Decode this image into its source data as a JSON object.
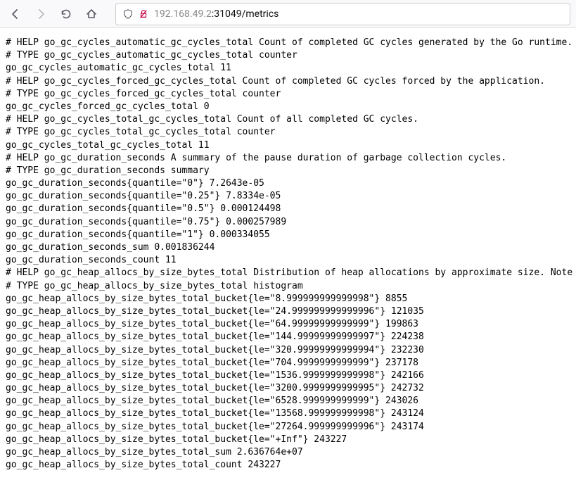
{
  "url": {
    "host": "192.168.49.2",
    "port_path": ":31049/metrics"
  },
  "metrics": [
    "# HELP go_gc_cycles_automatic_gc_cycles_total Count of completed GC cycles generated by the Go runtime.",
    "# TYPE go_gc_cycles_automatic_gc_cycles_total counter",
    "go_gc_cycles_automatic_gc_cycles_total 11",
    "# HELP go_gc_cycles_forced_gc_cycles_total Count of completed GC cycles forced by the application.",
    "# TYPE go_gc_cycles_forced_gc_cycles_total counter",
    "go_gc_cycles_forced_gc_cycles_total 0",
    "# HELP go_gc_cycles_total_gc_cycles_total Count of all completed GC cycles.",
    "# TYPE go_gc_cycles_total_gc_cycles_total counter",
    "go_gc_cycles_total_gc_cycles_total 11",
    "# HELP go_gc_duration_seconds A summary of the pause duration of garbage collection cycles.",
    "# TYPE go_gc_duration_seconds summary",
    "go_gc_duration_seconds{quantile=\"0\"} 7.2643e-05",
    "go_gc_duration_seconds{quantile=\"0.25\"} 7.8334e-05",
    "go_gc_duration_seconds{quantile=\"0.5\"} 0.000124498",
    "go_gc_duration_seconds{quantile=\"0.75\"} 0.000257989",
    "go_gc_duration_seconds{quantile=\"1\"} 0.000334055",
    "go_gc_duration_seconds_sum 0.001836244",
    "go_gc_duration_seconds_count 11",
    "# HELP go_gc_heap_allocs_by_size_bytes_total Distribution of heap allocations by approximate size. Note that thi",
    "# TYPE go_gc_heap_allocs_by_size_bytes_total histogram",
    "go_gc_heap_allocs_by_size_bytes_total_bucket{le=\"8.999999999999998\"} 8855",
    "go_gc_heap_allocs_by_size_bytes_total_bucket{le=\"24.999999999999996\"} 121035",
    "go_gc_heap_allocs_by_size_bytes_total_bucket{le=\"64.99999999999999\"} 199863",
    "go_gc_heap_allocs_by_size_bytes_total_bucket{le=\"144.99999999999997\"} 224238",
    "go_gc_heap_allocs_by_size_bytes_total_bucket{le=\"320.99999999999994\"} 232230",
    "go_gc_heap_allocs_by_size_bytes_total_bucket{le=\"704.9999999999999\"} 237178",
    "go_gc_heap_allocs_by_size_bytes_total_bucket{le=\"1536.9999999999998\"} 242166",
    "go_gc_heap_allocs_by_size_bytes_total_bucket{le=\"3200.9999999999995\"} 242732",
    "go_gc_heap_allocs_by_size_bytes_total_bucket{le=\"6528.999999999999\"} 243026",
    "go_gc_heap_allocs_by_size_bytes_total_bucket{le=\"13568.999999999998\"} 243124",
    "go_gc_heap_allocs_by_size_bytes_total_bucket{le=\"27264.999999999996\"} 243174",
    "go_gc_heap_allocs_by_size_bytes_total_bucket{le=\"+Inf\"} 243227",
    "go_gc_heap_allocs_by_size_bytes_total_sum 2.636764e+07",
    "go_gc_heap_allocs_by_size_bytes_total_count 243227"
  ]
}
